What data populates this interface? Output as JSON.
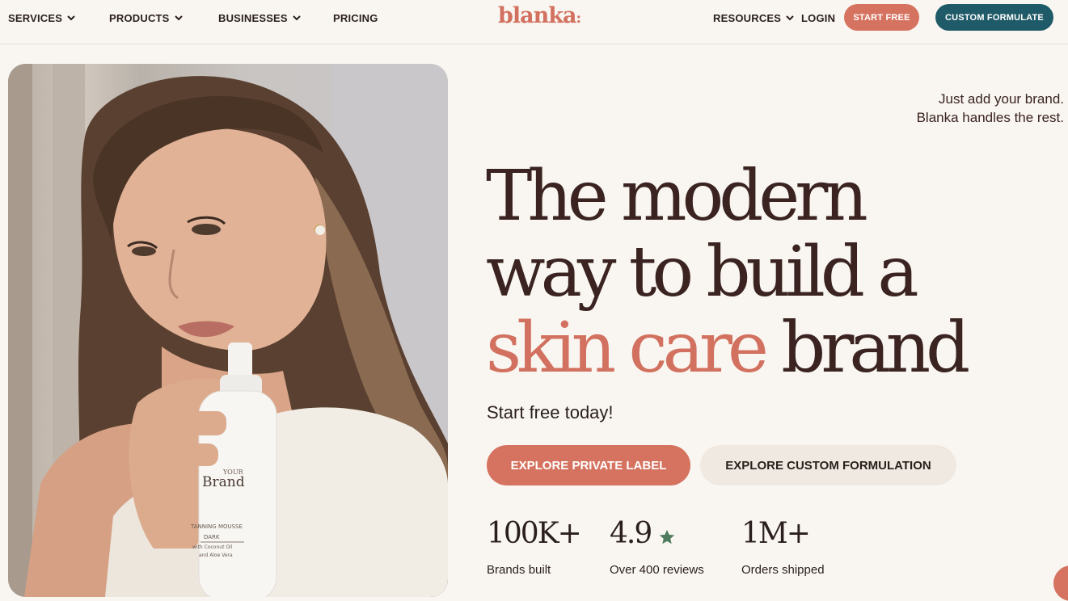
{
  "nav": {
    "services": "SERVICES",
    "products": "PRODUCTS",
    "businesses": "BUSINESSES",
    "pricing": "PRICING",
    "logo": "blanka",
    "logo_dot": ":",
    "resources": "RESOURCES",
    "login": "LOGIN",
    "start_free": "START FREE",
    "custom_formulate": "CUSTOM FORMULATE"
  },
  "hero": {
    "tagline_line1": "Just add your brand.",
    "tagline_line2": "Blanka handles the rest.",
    "headline_line1": "The modern",
    "headline_line2": "way to build a",
    "headline_accent": "skin care",
    "headline_end": "brand",
    "subhead": "Start free today!",
    "cta_private_label": "EXPLORE PRIVATE LABEL",
    "cta_custom_formulation": "EXPLORE CUSTOM FORMULATION",
    "bottle_brand_small": "YOUR",
    "bottle_brand": "Brand",
    "bottle_product": "TANNING MOUSSE",
    "bottle_variant": "DARK",
    "bottle_desc1": "with Coconut Oil",
    "bottle_desc2": "and Aloe Vera"
  },
  "stats": [
    {
      "value": "100K+",
      "label": "Brands built"
    },
    {
      "value": "4.9",
      "label": "Over 400 reviews"
    },
    {
      "value": "1M+",
      "label": "Orders shipped"
    }
  ],
  "colors": {
    "accent": "#d57360",
    "teal": "#1f5a68",
    "background": "#f9f6f1",
    "text": "#3a2320",
    "star": "#4f7a5c"
  }
}
